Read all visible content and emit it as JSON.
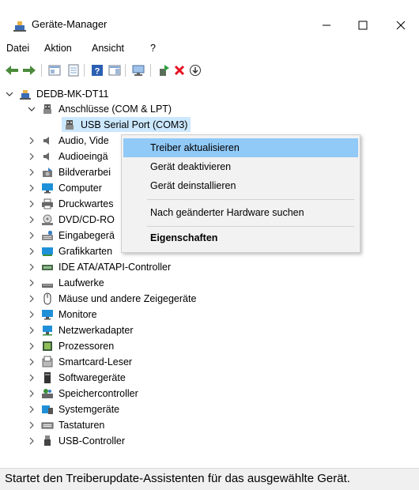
{
  "window": {
    "title": "Geräte-Manager"
  },
  "menu": [
    "Datei",
    "Aktion",
    "Ansicht",
    "?"
  ],
  "toolbar": {
    "icons": [
      "back-icon",
      "forward-icon",
      "properties-pane-icon",
      "device-properties-icon",
      "help-icon",
      "console-view-icon",
      "scan-hardware-icon",
      "update-driver-icon",
      "uninstall-icon",
      "download-icon"
    ]
  },
  "tree": {
    "root": "DEDB-MK-DT11",
    "category_open": "Anschlüsse (COM & LPT)",
    "selected_device": "USB Serial Port (COM3)",
    "categories": [
      "Audio, Vide",
      "Audioeingä",
      "Bildverarbei",
      "Computer",
      "Druckwartes",
      "DVD/CD-RO",
      "Eingabegerä",
      "Grafikkarten",
      "IDE ATA/ATAPI-Controller",
      "Laufwerke",
      "Mäuse und andere Zeigegeräte",
      "Monitore",
      "Netzwerkadapter",
      "Prozessoren",
      "Smartcard-Leser",
      "Softwaregeräte",
      "Speichercontroller",
      "Systemgeräte",
      "Tastaturen",
      "USB-Controller"
    ]
  },
  "context_menu": {
    "items": [
      "Treiber aktualisieren",
      "Gerät deaktivieren",
      "Gerät deinstallieren",
      "Nach geänderter Hardware suchen",
      "Eigenschaften"
    ]
  },
  "status": "Startet den Treiberupdate-Assistenten für das ausgewählte Gerät.",
  "colors": {
    "selection": "#cce8ff",
    "menu_highlight": "#91c9f7",
    "delete_red": "#e81123"
  }
}
